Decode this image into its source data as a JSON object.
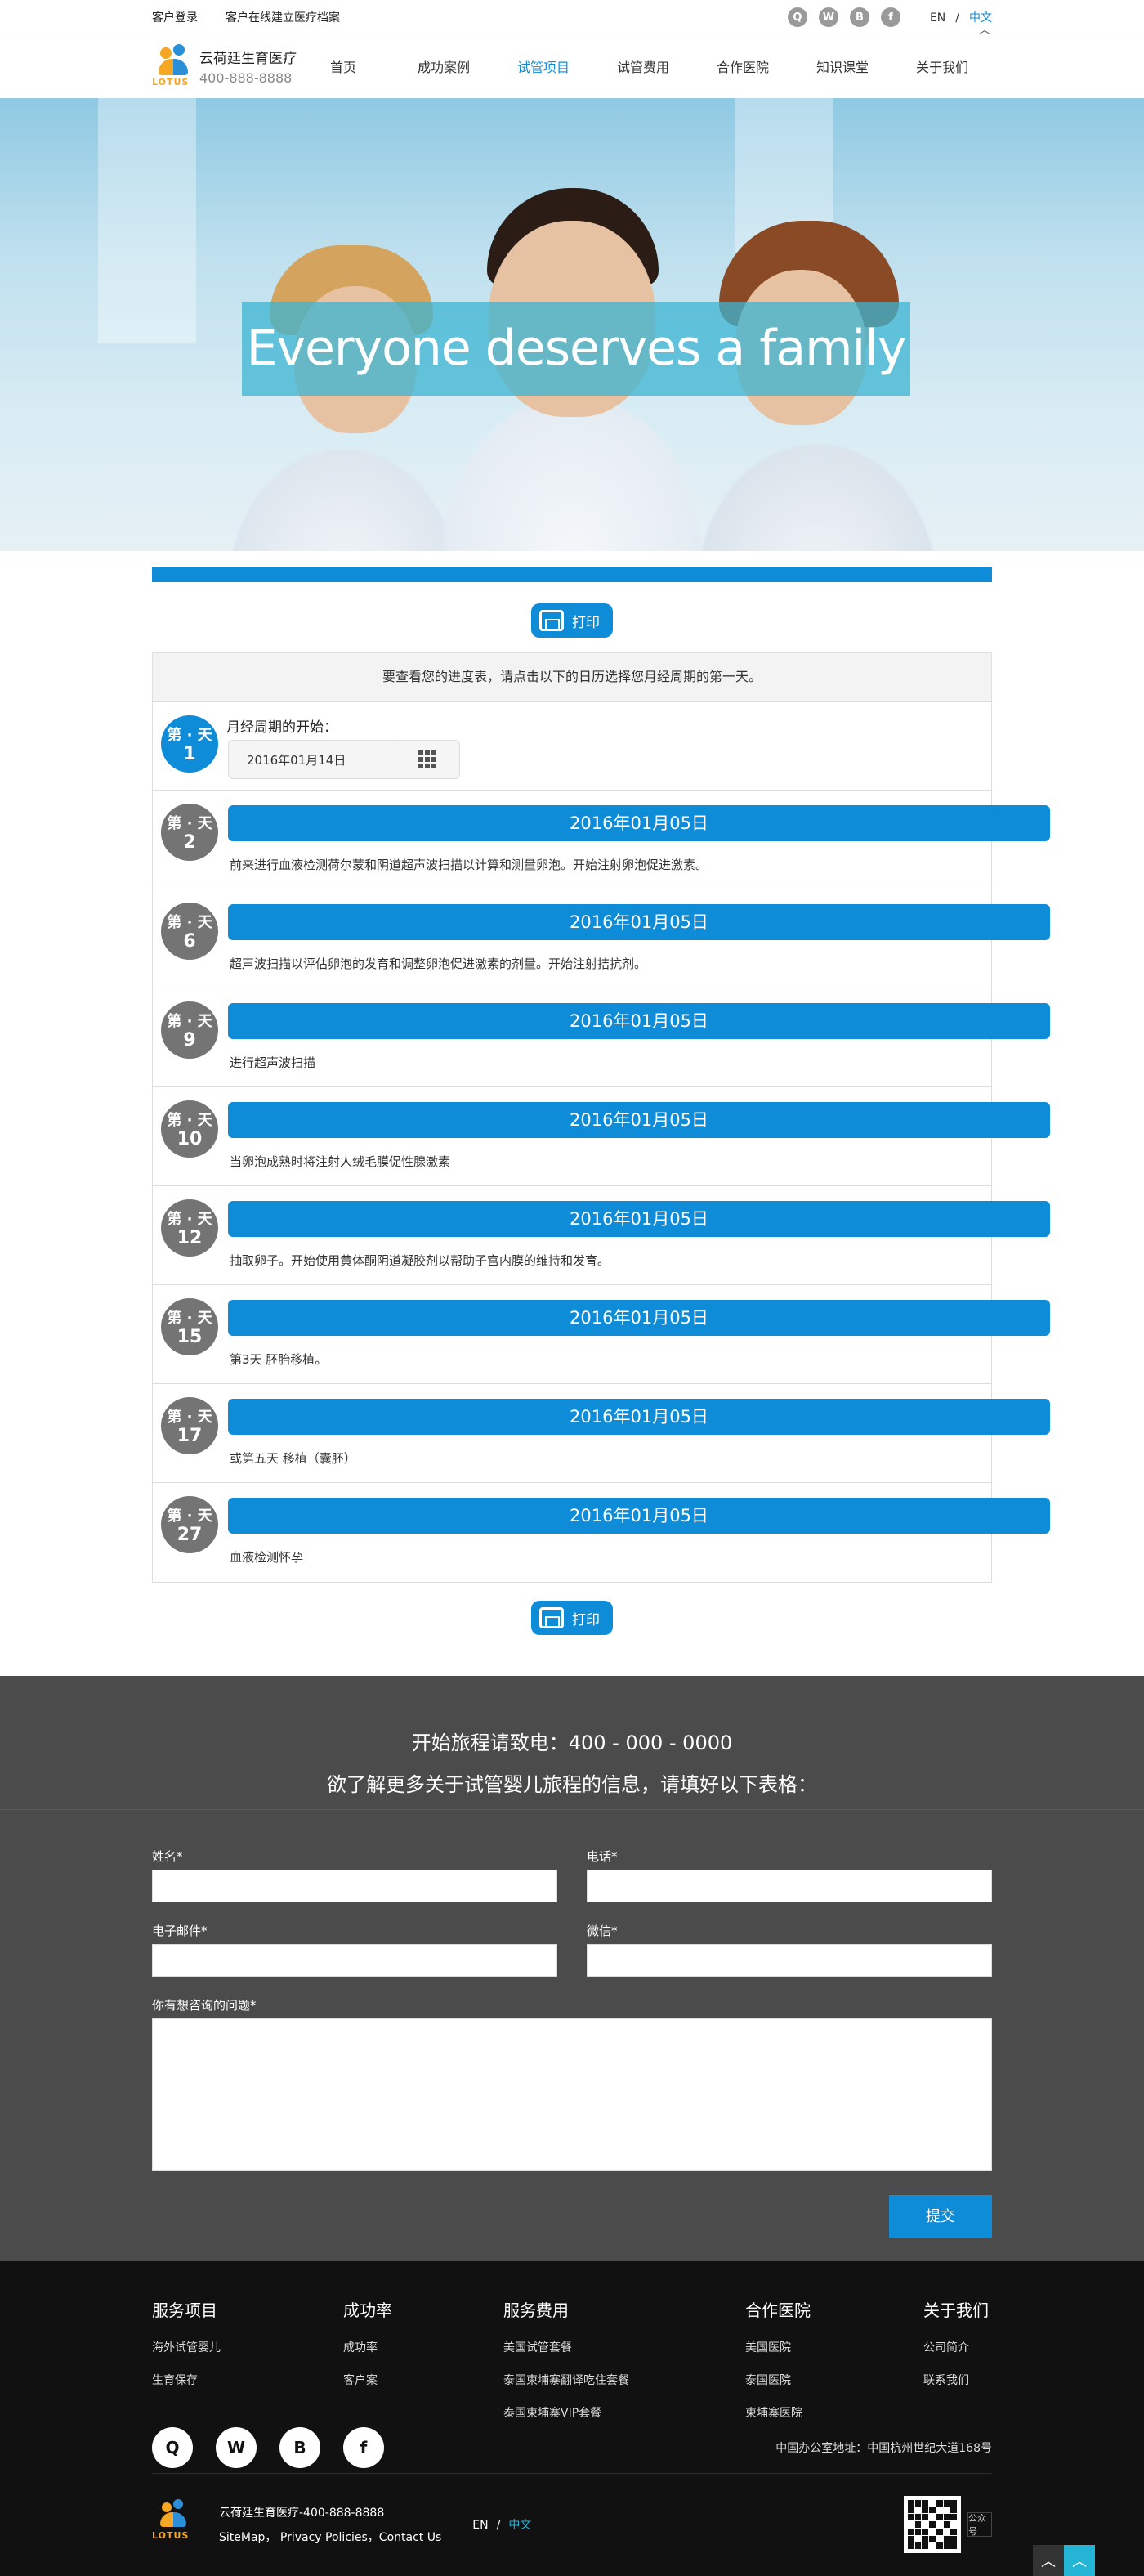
{
  "topbar": {
    "login": "客户登录",
    "archive": "客户在线建立医疗档案",
    "social": [
      "qq-icon",
      "wechat-icon",
      "weibo-icon",
      "facebook-icon"
    ],
    "lang_en": "EN",
    "lang_sep": "/",
    "lang_cn": "中文"
  },
  "header": {
    "logo_word": "LOTUS",
    "company": "云荷廷生育医疗",
    "phone": "400-888-8888",
    "nav": [
      "首页",
      "成功案例",
      "试管项目",
      "试管费用",
      "合作医院",
      "知识课堂",
      "关于我们"
    ],
    "active_nav": "试管项目"
  },
  "hero": {
    "caption": "Everyone deserves a family"
  },
  "main": {
    "print_label": "打印",
    "instruction": "要查看您的进度表，请点击以下的日历选择您月经周期的第一天。",
    "start": {
      "day_word": "第 · 天",
      "day_num": "1",
      "label": "月经周期的开始：",
      "date_value": "2016年01月14日"
    },
    "rows": [
      {
        "day_word": "第 · 天",
        "day_num": "2",
        "date": "2016年01月05日",
        "desc": "前来进行血液检测荷尔蒙和阴道超声波扫描以计算和测量卵泡。开始注射卵泡促进激素。"
      },
      {
        "day_word": "第 · 天",
        "day_num": "6",
        "date": "2016年01月05日",
        "desc": "超声波扫描以评估卵泡的发育和调整卵泡促进激素的剂量。开始注射拮抗剂。"
      },
      {
        "day_word": "第 · 天",
        "day_num": "9",
        "date": "2016年01月05日",
        "desc": "进行超声波扫描"
      },
      {
        "day_word": "第 · 天",
        "day_num": "10",
        "date": "2016年01月05日",
        "desc": "当卵泡成熟时将注射人绒毛膜促性腺激素"
      },
      {
        "day_word": "第 · 天",
        "day_num": "12",
        "date": "2016年01月05日",
        "desc": "抽取卵子。开始使用黄体酮阴道凝胶剂以帮助子宫内膜的维持和发育。"
      },
      {
        "day_word": "第 · 天",
        "day_num": "15",
        "date": "2016年01月05日",
        "desc": "第3天 胚胎移植。"
      },
      {
        "day_word": "第 · 天",
        "day_num": "17",
        "date": "2016年01月05日",
        "desc": "或第五天 移植（囊胚）"
      },
      {
        "day_word": "第 · 天",
        "day_num": "27",
        "date": "2016年01月05日",
        "desc": "血液检测怀孕"
      }
    ]
  },
  "contact": {
    "line1": "开始旅程请致电：400 - 000 - 0000",
    "line2": "欲了解更多关于试管婴儿旅程的信息，请填好以下表格：",
    "name_label": "姓名*",
    "phone_label": "电话*",
    "email_label": "电子邮件*",
    "wechat_label": "微信*",
    "question_label": "你有想咨询的问题*",
    "submit": "提交"
  },
  "footer": {
    "cols": [
      {
        "title": "服务项目",
        "items": [
          "海外试管婴儿",
          "生育保存"
        ]
      },
      {
        "title": "成功率",
        "items": [
          "成功率",
          "客户案"
        ]
      },
      {
        "title": "服务费用",
        "items": [
          "美国试管套餐",
          "泰国柬埔寨翻译吃住套餐",
          "泰国柬埔寨VIP套餐"
        ]
      },
      {
        "title": "合作医院",
        "items": [
          "美国医院",
          "泰国医院",
          "柬埔寨医院"
        ]
      },
      {
        "title": "关于我们",
        "items": [
          "公司简介",
          "联系我们"
        ]
      }
    ],
    "address": "中国办公室地址：中国杭州世纪大道168号",
    "bottom_line1": "云荷廷生育医疗-400-888-8888",
    "bottom_line2": "SiteMap， Privacy Policies，Contact Us",
    "lang_en": "EN",
    "lang_sep": "/",
    "lang_cn": "中文",
    "qr_side": "公众号"
  },
  "colors": {
    "accent": "#0f8cd8",
    "teal": "#23b4d6",
    "footer_bg": "#111111",
    "contact_bg": "#4b4b4b"
  }
}
